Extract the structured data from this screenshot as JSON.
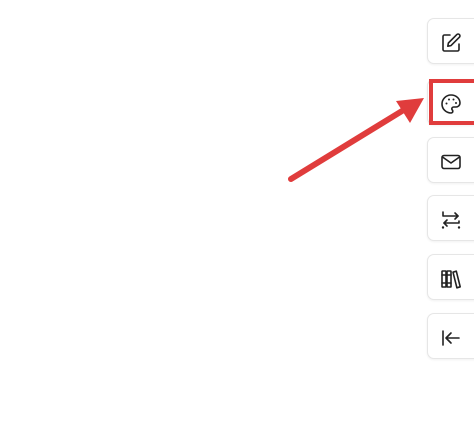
{
  "toolbar": {
    "items": [
      {
        "icon": "edit-icon"
      },
      {
        "icon": "palette-icon"
      },
      {
        "icon": "mail-icon"
      },
      {
        "icon": "transfer-icon"
      },
      {
        "icon": "library-icon"
      },
      {
        "icon": "collapse-left-icon"
      }
    ]
  },
  "annotation": {
    "highlighted_item": "palette-icon",
    "color": "#e03c3c"
  }
}
